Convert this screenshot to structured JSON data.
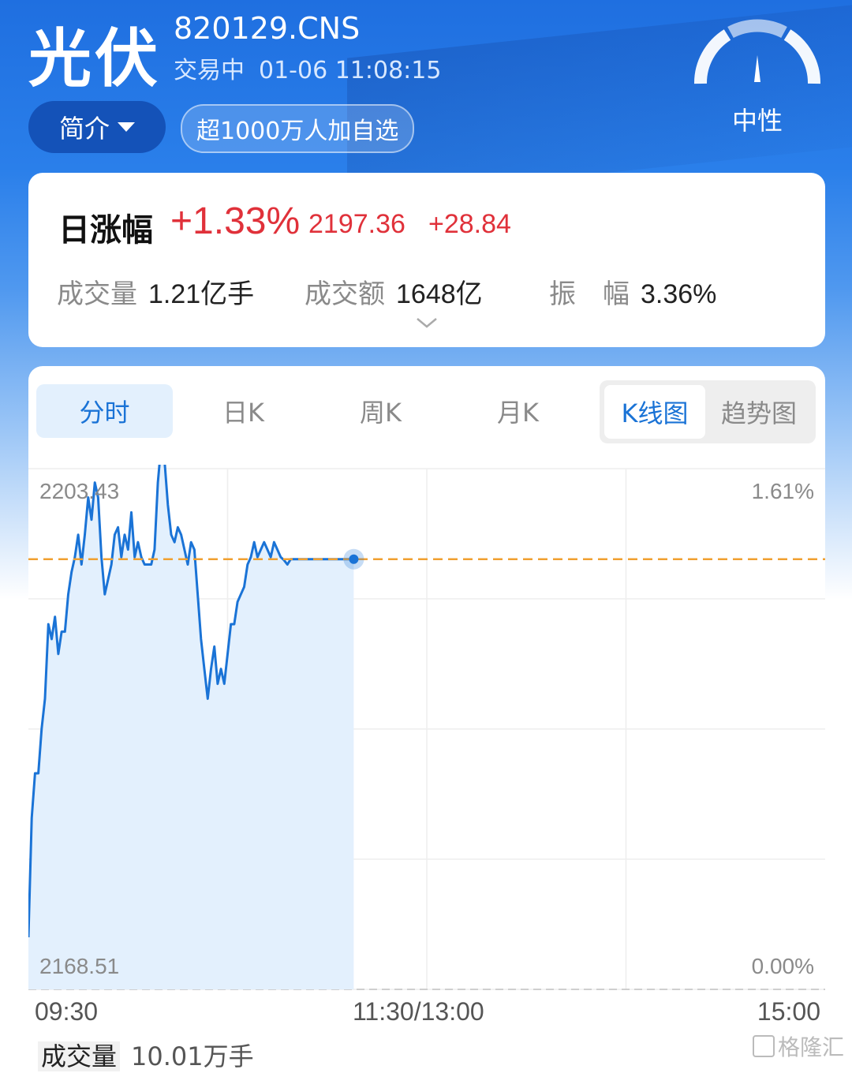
{
  "header": {
    "name": "光伏",
    "code": "820129.CNS",
    "status": "交易中",
    "datetime": "01-06 11:08:15",
    "intro_label": "简介",
    "watch_tag": "超1000万人加自选",
    "sentiment": "中性"
  },
  "quote": {
    "label": "日涨幅",
    "change_pct": "+1.33%",
    "price": "2197.36",
    "change": "+28.84",
    "volume_label": "成交量",
    "volume": "1.21亿手",
    "amount_label": "成交额",
    "amount": "1648亿",
    "amplitude_label": "振　幅",
    "amplitude": "3.36%"
  },
  "tabs": [
    "分时",
    "日K",
    "周K",
    "月K"
  ],
  "chart_mode": [
    "K线图",
    "趋势图"
  ],
  "colors": {
    "up": "#e0313a",
    "line": "#1a73d6",
    "ref": "#f0a030",
    "fill": "#e3f0fd"
  },
  "chart_data": {
    "type": "line",
    "ylim": [
      2168.51,
      2203.43
    ],
    "y_top_label": "2203.43",
    "y_bottom_label": "2168.51",
    "y_right_top": "1.61%",
    "y_right_bottom": "0.00%",
    "reference": 2197.36,
    "x_labels": [
      "09:30",
      "11:30/13:00",
      "15:00"
    ],
    "total_minutes": 240,
    "series": [
      {
        "x": [
          0,
          1,
          2,
          3,
          4,
          5,
          6,
          7,
          8,
          9,
          10,
          11,
          12,
          13,
          14,
          15,
          16,
          17,
          18,
          19,
          20,
          21,
          22,
          23,
          24,
          25,
          26,
          27,
          28,
          29,
          30,
          31,
          32,
          33,
          34,
          35,
          36,
          37,
          38,
          39,
          40,
          41,
          42,
          43,
          44,
          45,
          46,
          47,
          48,
          49,
          50,
          51,
          52,
          53,
          54,
          55,
          56,
          57,
          58,
          59,
          60,
          61,
          62,
          63,
          64,
          65,
          66,
          67,
          68,
          69,
          70,
          71,
          72,
          73,
          74,
          75,
          76,
          77,
          78,
          79,
          80,
          81,
          82,
          83,
          84,
          85,
          86,
          87,
          88,
          89,
          90,
          91,
          92,
          93,
          94,
          95,
          96,
          97,
          98
        ],
        "values": [
          2172.0,
          2180.0,
          2183.0,
          2183.0,
          2186.0,
          2188.0,
          2193.0,
          2192.0,
          2193.5,
          2191.0,
          2192.5,
          2192.5,
          2195.0,
          2196.5,
          2197.5,
          2199.0,
          2197.0,
          2199.0,
          2201.5,
          2200.0,
          2202.5,
          2201.5,
          2197.5,
          2195.0,
          2196.0,
          2197.0,
          2199.0,
          2199.5,
          2197.5,
          2199.0,
          2198.0,
          2200.5,
          2197.5,
          2198.5,
          2197.5,
          2197.0,
          2197.0,
          2197.0,
          2198.0,
          2202.5,
          2205.0,
          2204.0,
          2201.0,
          2199.0,
          2198.5,
          2199.5,
          2199.0,
          2198.0,
          2197.0,
          2198.5,
          2198.0,
          2195.0,
          2192.0,
          2190.0,
          2188.0,
          2190.0,
          2191.5,
          2189.0,
          2190.0,
          2189.0,
          2191.0,
          2193.0,
          2193.0,
          2194.5,
          2195.0,
          2195.5,
          2197.0,
          2197.5,
          2198.5,
          2197.5,
          2198.0,
          2198.5,
          2198.0,
          2197.5,
          2198.5,
          2198.0,
          2197.5,
          2197.3,
          2197.0,
          2197.36,
          2197.36,
          2197.36,
          2197.36,
          2197.36,
          2197.36,
          2197.36,
          2197.36,
          2197.36,
          2197.36,
          2197.36,
          2197.36,
          2197.36,
          2197.36,
          2197.36,
          2197.36,
          2197.36,
          2197.36,
          2197.36,
          2197.36
        ]
      }
    ]
  },
  "volume_bar": {
    "label": "成交量",
    "value": "10.01万手"
  },
  "watermark": "格隆汇"
}
